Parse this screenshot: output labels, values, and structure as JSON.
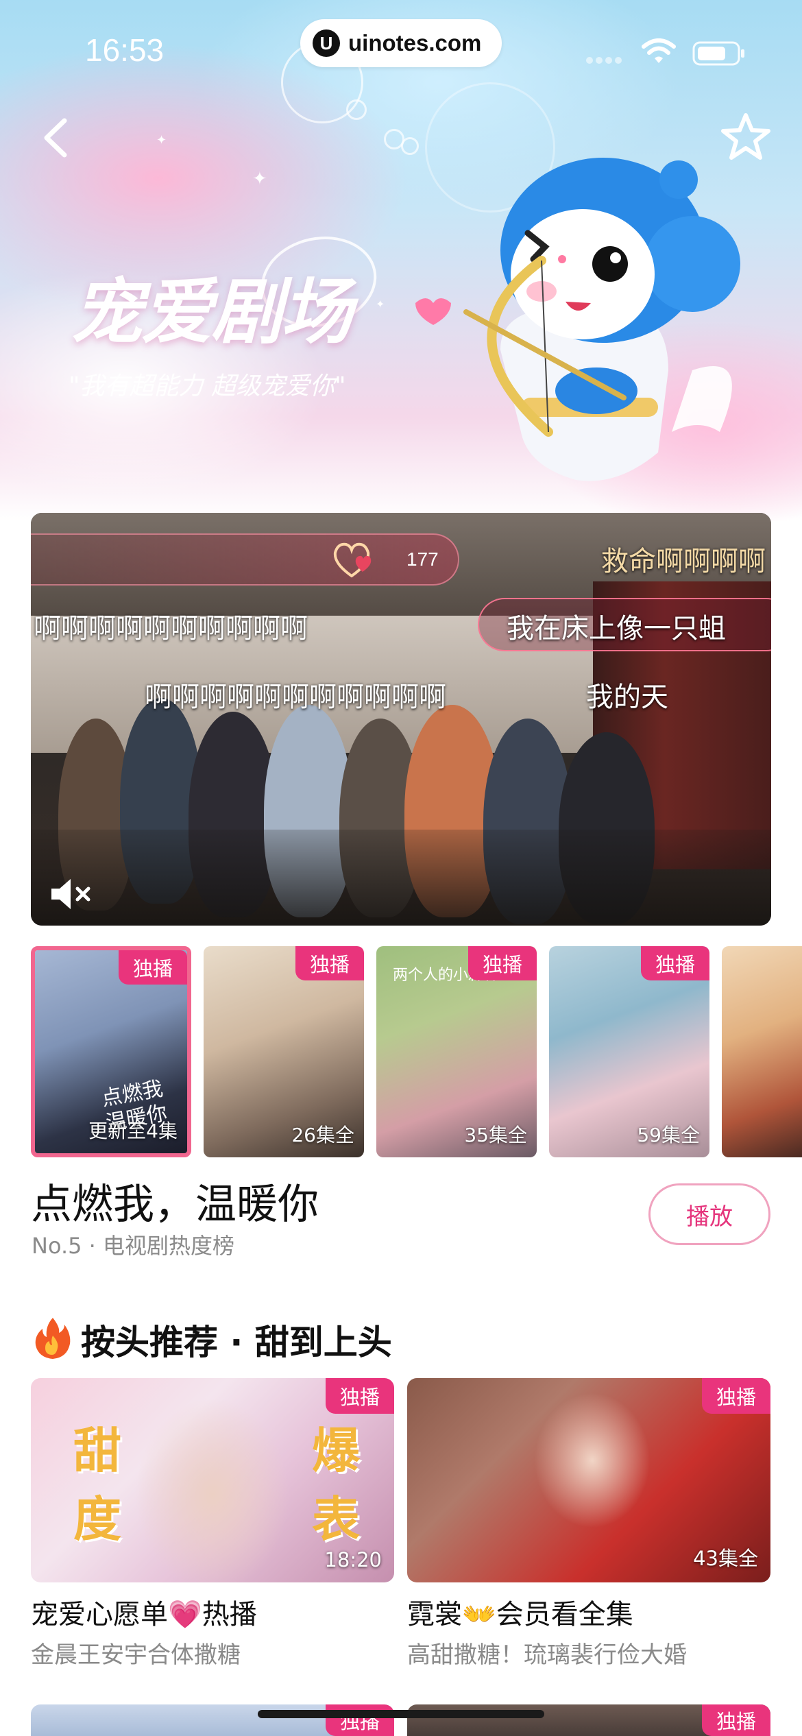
{
  "status_bar": {
    "time": "16:53",
    "url": "uinotes.com"
  },
  "hero": {
    "title": "宠爱剧场",
    "slogan": "\"我有超能力 超级宠爱你\""
  },
  "video": {
    "like_count": "177",
    "danmaku": [
      "救命啊啊啊啊",
      "啊啊啊啊啊啊啊啊啊啊",
      "我在床上像一只蛆",
      "啊啊啊啊啊啊啊啊啊啊啊",
      "我的天"
    ]
  },
  "thumbnails": [
    {
      "badge": "独播",
      "episodes": "更新至4集",
      "selected": true,
      "overlay": "点燃我 温暖你"
    },
    {
      "badge": "独播",
      "episodes": "26集全"
    },
    {
      "badge": "独播",
      "episodes": "35集全",
      "overlay": "两个人的小森林"
    },
    {
      "badge": "独播",
      "episodes": "59集全"
    },
    {
      "badge": "",
      "episodes": ""
    }
  ],
  "show": {
    "title": "点燃我，温暖你",
    "rank": "No.5 · 电视剧热度榜",
    "play_label": "播放"
  },
  "section": {
    "title": "按头推荐 · 甜到上头",
    "cards": [
      {
        "badge": "独播",
        "meta": "18:20",
        "title": "宠爱心愿单💗热播",
        "subtitle": "金晨王安宇合体撒糖",
        "art_left": "甜度",
        "art_right": "爆表"
      },
      {
        "badge": "独播",
        "meta": "43集全",
        "title": "霓裳👐会员看全集",
        "subtitle": "高甜撒糖！琉璃裴行俭大婚"
      }
    ],
    "next_badges": [
      "独播",
      "独播"
    ]
  },
  "colors": {
    "accent": "#e9347c",
    "pink_border": "#f0a3bf"
  },
  "icons": [
    "back-icon",
    "star-icon",
    "mute-icon",
    "fire-icon",
    "wifi-icon",
    "battery-icon",
    "heart-icon"
  ]
}
